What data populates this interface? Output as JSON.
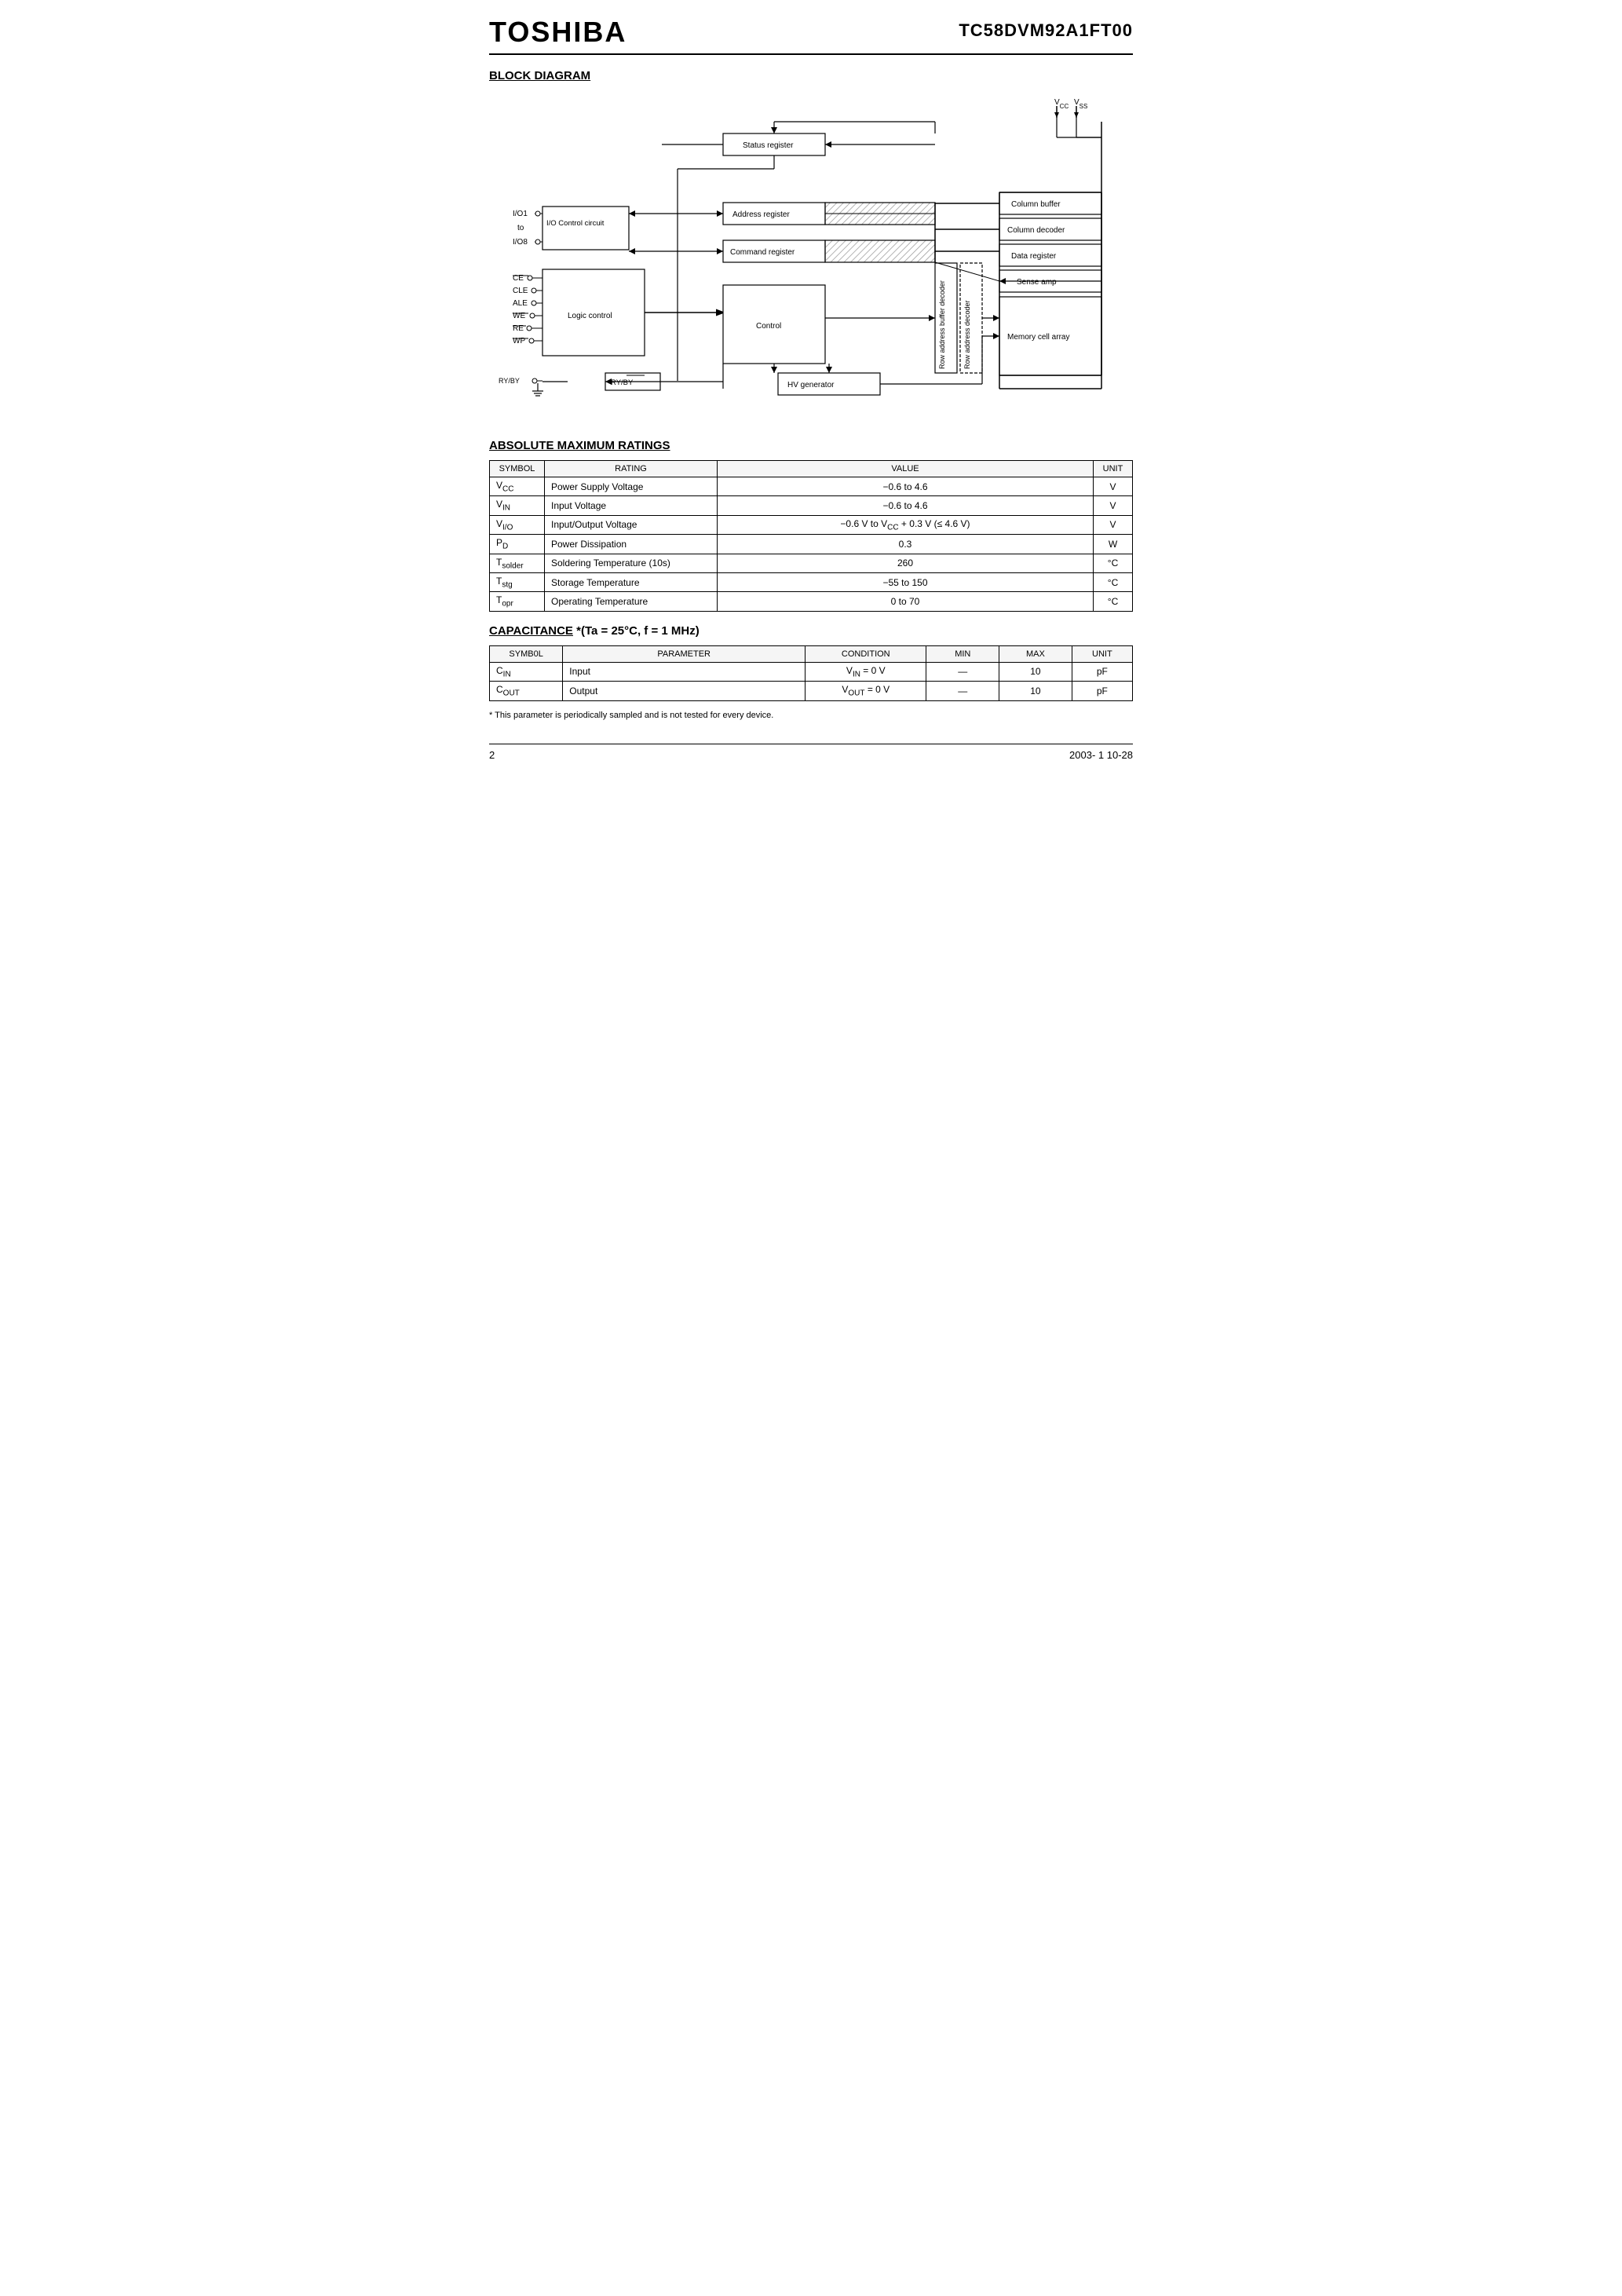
{
  "header": {
    "logo": "TOSHIBA",
    "part_number": "TC58DVM92A1FT00"
  },
  "sections": {
    "block_diagram": "BLOCK DIAGRAM",
    "abs_max": "ABSOLUTE MAXIMUM RATINGS",
    "capacitance": "CAPACITANCE",
    "cap_condition": "*(Ta = 25°C, f = 1 MHz)"
  },
  "block_diagram_labels": {
    "status_register": "Status register",
    "address_register": "Address register",
    "command_register": "Command register",
    "io_control": "I/O Control circuit",
    "io1": "I/O1",
    "to": "to",
    "io8": "I/O8",
    "ce": "CE",
    "cle": "CLE",
    "ale": "ALE",
    "we": "WE",
    "re": "RE",
    "wp": "WP",
    "ryby": "RY/BY",
    "logic_control": "Logic control",
    "control": "Control",
    "ry_by_box": "RY/BY",
    "hv_generator": "HV generator",
    "row_addr_buf": "Row address buffer decoder",
    "row_addr_dec": "Row address decoder",
    "column_buffer": "Column buffer",
    "column_decoder": "Column decoder",
    "data_register": "Data register",
    "sense_amp": "Sense amp",
    "memory_cell": "Memory cell array",
    "vcc": "VCC",
    "vss": "VSS"
  },
  "abs_max_table": {
    "headers": [
      "SYMBOL",
      "RATING",
      "VALUE",
      "UNIT"
    ],
    "rows": [
      {
        "symbol": "VCC",
        "sub": "CC",
        "rating": "Power Supply Voltage",
        "value": "−0.6 to 4.6",
        "unit": "V"
      },
      {
        "symbol": "VIN",
        "sub": "IN",
        "rating": "Input Voltage",
        "value": "−0.6 to 4.6",
        "unit": "V"
      },
      {
        "symbol": "VI/O",
        "sub": "I/O",
        "rating": "Input/Output Voltage",
        "value": "−0.6 V to VCC + 0.3 V (≤ 4.6 V)",
        "unit": "V"
      },
      {
        "symbol": "PD",
        "sub": "D",
        "rating": "Power Dissipation",
        "value": "0.3",
        "unit": "W"
      },
      {
        "symbol": "Tsolder",
        "sub": "solder",
        "rating": "Soldering Temperature (10s)",
        "value": "260",
        "unit": "°C"
      },
      {
        "symbol": "Tstg",
        "sub": "stg",
        "rating": "Storage Temperature",
        "value": "−55 to 150",
        "unit": "°C"
      },
      {
        "symbol": "Topr",
        "sub": "opr",
        "rating": "Operating Temperature",
        "value": "0 to 70",
        "unit": "°C"
      }
    ]
  },
  "cap_table": {
    "headers": [
      "SYMB0L",
      "PARAMETER",
      "CONDITION",
      "MIN",
      "MAX",
      "UNIT"
    ],
    "rows": [
      {
        "symbol": "CIN",
        "sub": "IN",
        "parameter": "Input",
        "condition": "VIN = 0 V",
        "min": "—",
        "max": "10",
        "unit": "pF"
      },
      {
        "symbol": "COUT",
        "sub": "OUT",
        "parameter": "Output",
        "condition": "VOUT = 0 V",
        "min": "—",
        "max": "10",
        "unit": "pF"
      }
    ]
  },
  "footnote": "* This parameter is periodically sampled and is not tested for every device.",
  "footer": {
    "page": "2",
    "date": "2003- 1 10-28"
  }
}
